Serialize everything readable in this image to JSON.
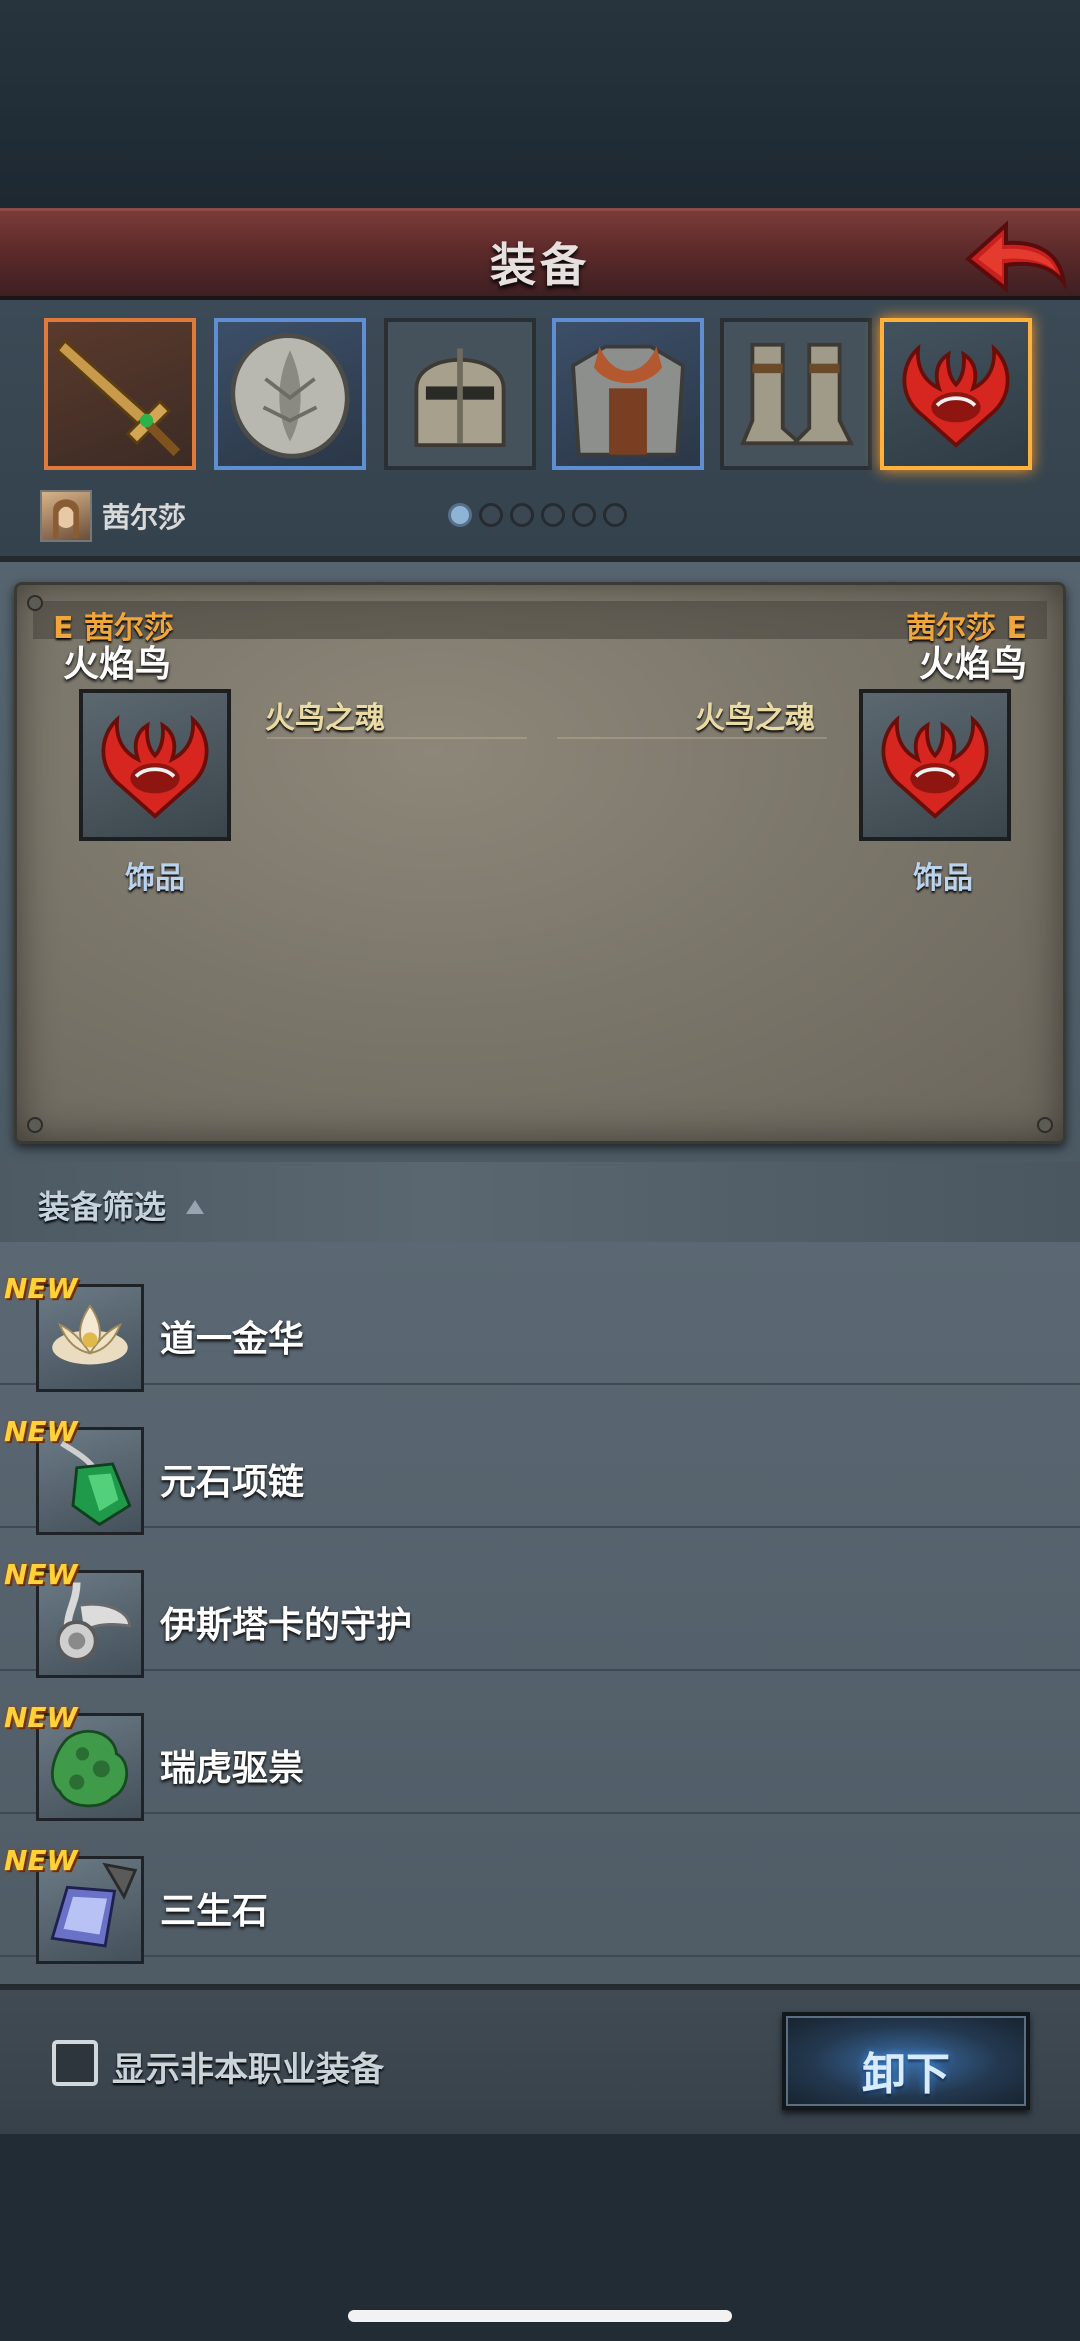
{
  "header": {
    "title": "装备"
  },
  "character": {
    "name": "茜尔莎"
  },
  "pager": {
    "pages": 6,
    "current": 1
  },
  "equipment_slots": [
    {
      "icon": "sword-icon",
      "frame": "orange"
    },
    {
      "icon": "shield-icon",
      "frame": "blue"
    },
    {
      "icon": "helmet-icon",
      "frame": "none"
    },
    {
      "icon": "armor-icon",
      "frame": "blue"
    },
    {
      "icon": "boots-icon",
      "frame": "none"
    },
    {
      "icon": "firebird-emblem-icon",
      "frame": "gold",
      "selected": true
    }
  ],
  "compare": {
    "left": {
      "owner_label": "E 茜尔莎",
      "item_name": "火焰鸟",
      "attribute": "火鸟之魂",
      "type": "饰品"
    },
    "right": {
      "owner_label": "茜尔莎 E",
      "item_name": "火焰鸟",
      "attribute": "火鸟之魂",
      "type": "饰品"
    }
  },
  "filter": {
    "label": "装备筛选"
  },
  "items": [
    {
      "name": "道一金华",
      "badge": "NEW",
      "icon": "lotus-icon"
    },
    {
      "name": "元石项链",
      "badge": "NEW",
      "icon": "green-crystal-necklace-icon"
    },
    {
      "name": "伊斯塔卡的守护",
      "badge": "NEW",
      "icon": "silver-amulet-icon"
    },
    {
      "name": "瑞虎驱祟",
      "badge": "NEW",
      "icon": "jade-tiger-icon"
    },
    {
      "name": "三生石",
      "badge": "NEW",
      "icon": "blue-crystal-icon"
    }
  ],
  "footer": {
    "checkbox_label": "显示非本职业装备",
    "checkbox_checked": false,
    "unequip_label": "卸下"
  },
  "colors": {
    "title_bar": "#5e2b2b",
    "new_badge": "#ffd23a",
    "owner_label": "#f0a63a",
    "button_glow": "#3e8fe8"
  }
}
